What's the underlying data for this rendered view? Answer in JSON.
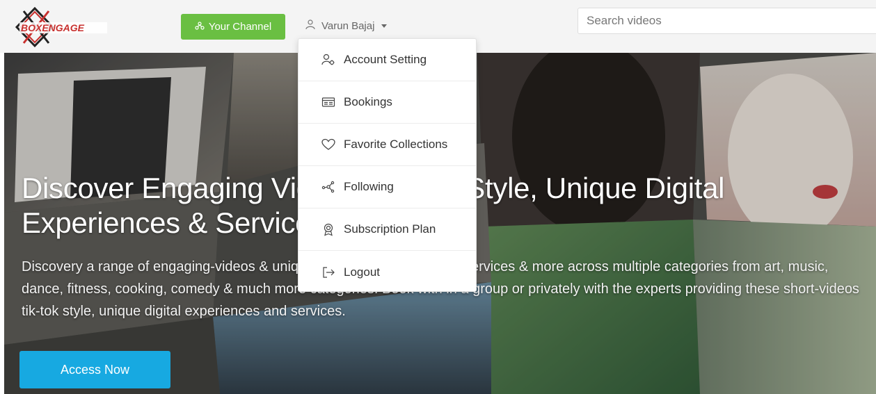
{
  "navbar": {
    "logo_text": "BOXENGAGE",
    "channel_button": "Your Channel",
    "user_name": "Varun Bajaj",
    "search_placeholder": "Search videos"
  },
  "dropdown": {
    "items": [
      {
        "label": "Account Setting",
        "icon": "user-gear-icon"
      },
      {
        "label": "Bookings",
        "icon": "ticket-icon"
      },
      {
        "label": "Favorite Collections",
        "icon": "heart-icon"
      },
      {
        "label": "Following",
        "icon": "network-icon"
      },
      {
        "label": "Subscription Plan",
        "icon": "badge-icon"
      },
      {
        "label": "Logout",
        "icon": "logout-icon"
      }
    ]
  },
  "hero": {
    "title": "Discover Engaging Videos Tik-Tok Style, Unique Digital Experiences & Services Online !",
    "description": "Discovery a range of engaging-videos & unique digital experiences and services & more across multiple categories from art, music, dance, fitness, cooking, comedy & much more categories. Book with in a group or privately with the experts providing these short-videos tik-tok style, unique digital experiences and services.",
    "button": "Access Now"
  },
  "colors": {
    "channel_green": "#6abf42",
    "access_blue": "#17a9e1",
    "logo_red": "#c8302e"
  }
}
